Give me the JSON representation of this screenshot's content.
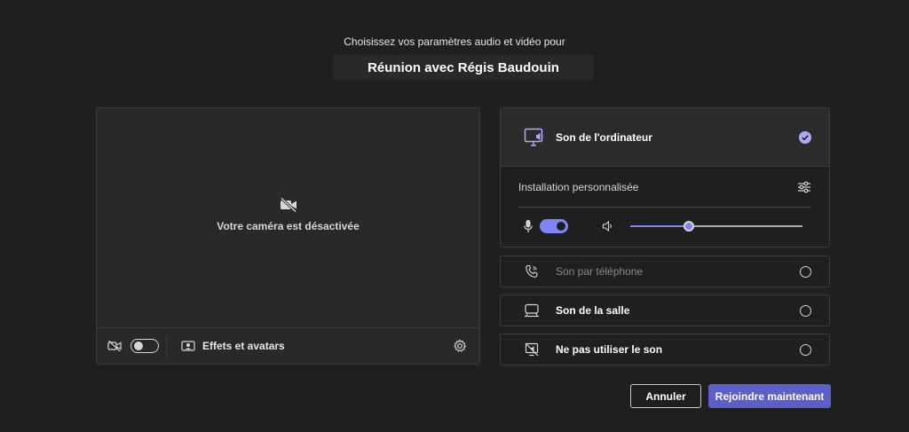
{
  "header": {
    "subtitle": "Choisissez vos paramètres audio et vidéo pour",
    "meeting_title": "Réunion avec Régis Baudouin"
  },
  "preview": {
    "camera_off_text": "Votre caméra est désactivée",
    "camera_toggle_on": false,
    "effects_label": "Effets et avatars"
  },
  "audio": {
    "computer_sound": {
      "label": "Son de l'ordinateur",
      "selected": true,
      "custom_setup_label": "Installation personnalisée",
      "mic_enabled": true,
      "volume_fraction": 0.34
    },
    "options": [
      {
        "label": "Son par téléphone",
        "disabled": true,
        "icon": "phone-icon"
      },
      {
        "label": "Son de la salle",
        "disabled": false,
        "icon": "room-icon"
      },
      {
        "label": "Ne pas utiliser le son",
        "disabled": false,
        "icon": "no-audio-icon"
      }
    ]
  },
  "actions": {
    "cancel_label": "Annuler",
    "join_label": "Rejoindre maintenant"
  },
  "colors": {
    "background": "#1f1f1f",
    "accent": "#7f85f5",
    "primary_button": "#5b5fc7"
  }
}
